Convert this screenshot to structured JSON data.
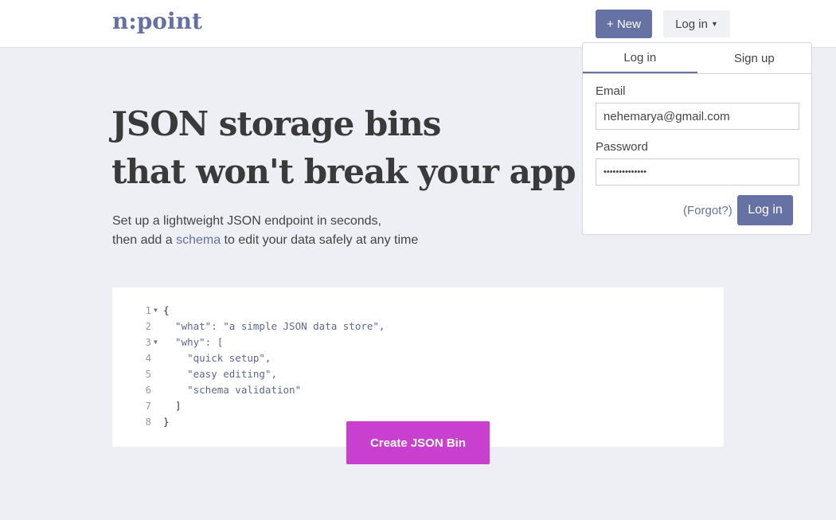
{
  "nav": {
    "logo": "n:point",
    "new_label": "+ New",
    "login_label": "Log in"
  },
  "hero": {
    "title_line1": "JSON storage bins",
    "title_line2": "that won't break your app",
    "sub_line1": "Set up a lightweight JSON endpoint in seconds,",
    "sub_line2_pre": "then add a ",
    "sub_line2_link": "schema",
    "sub_line2_post": " to edit your data safely at any time"
  },
  "editor": {
    "lines": [
      {
        "n": "1",
        "fold": true,
        "text": "{"
      },
      {
        "n": "2",
        "fold": false,
        "text": "  \"what\": \"a simple JSON data store\","
      },
      {
        "n": "3",
        "fold": true,
        "text": "  \"why\": ["
      },
      {
        "n": "4",
        "fold": false,
        "text": "    \"quick setup\","
      },
      {
        "n": "5",
        "fold": false,
        "text": "    \"easy editing\","
      },
      {
        "n": "6",
        "fold": false,
        "text": "    \"schema validation\""
      },
      {
        "n": "7",
        "fold": false,
        "text": "  ]"
      },
      {
        "n": "8",
        "fold": false,
        "text": "}"
      }
    ]
  },
  "create_label": "Create JSON Bin",
  "login_dropdown": {
    "tabs": [
      "Log in",
      "Sign up"
    ],
    "active_tab": "Log in",
    "email_label": "Email",
    "email_value": "nehemarya@gmail.com",
    "password_label": "Password",
    "password_value": "••••••••••••••",
    "forgot_label": "(Forgot?)",
    "submit_label": "Log in"
  },
  "colors": {
    "accent": "#6572a3",
    "create": "#c93fcf",
    "background": "#eeeff4"
  }
}
